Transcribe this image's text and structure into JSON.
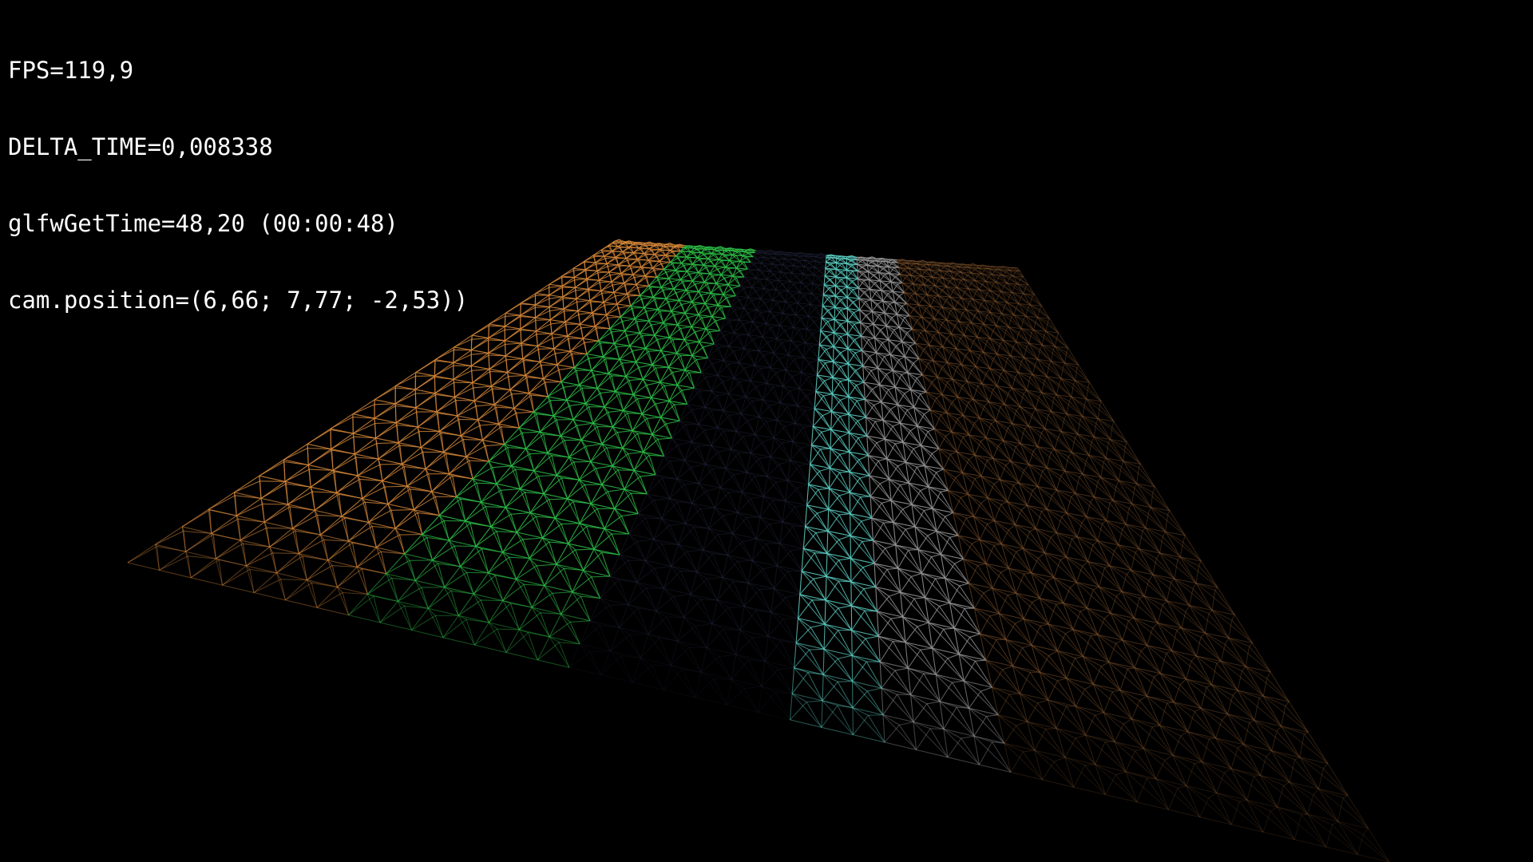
{
  "hud": {
    "fps": "FPS=119,9",
    "delta_time": "DELTA_TIME=0,008338",
    "glfw_time": "glfwGetTime=48,20 (00:00:48)",
    "cam_position": "cam.position=(6,66; 7,77; -2,53))"
  },
  "scene": {
    "type": "wireframe-terrain-grid",
    "background": "#000000",
    "strips": [
      {
        "name": "orange-strip",
        "color": "#d98a3a"
      },
      {
        "name": "green-strip",
        "color": "#2fc44a"
      },
      {
        "name": "dark-blue-strip",
        "color": "#2a2e4a"
      },
      {
        "name": "grey-strip",
        "color": "#9a9a9a"
      },
      {
        "name": "cyan-tint",
        "color": "#5fd4c8"
      },
      {
        "name": "brown-strip",
        "color": "#8a5a30"
      }
    ]
  }
}
